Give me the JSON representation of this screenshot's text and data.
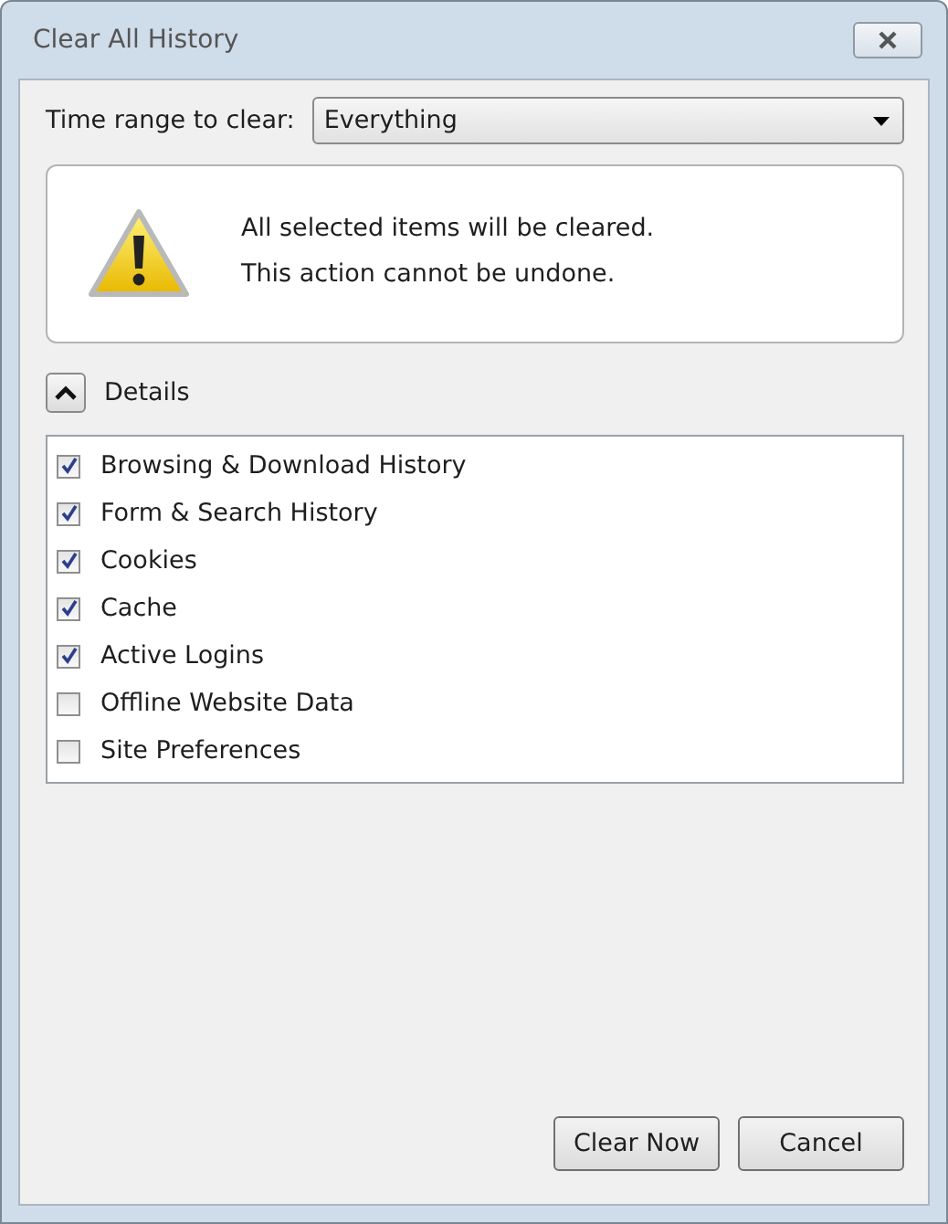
{
  "window": {
    "title": "Clear All History"
  },
  "time_range": {
    "label": "Time range to clear:",
    "value": "Everything"
  },
  "warning": {
    "lines": [
      "All selected items will be cleared.",
      "This action cannot be undone."
    ]
  },
  "details": {
    "label": "Details",
    "expanded": true
  },
  "items": [
    {
      "label": "Browsing & Download History",
      "checked": true
    },
    {
      "label": "Form & Search History",
      "checked": true
    },
    {
      "label": "Cookies",
      "checked": true
    },
    {
      "label": "Cache",
      "checked": true
    },
    {
      "label": "Active Logins",
      "checked": true
    },
    {
      "label": "Offline Website Data",
      "checked": false
    },
    {
      "label": "Site Preferences",
      "checked": false
    }
  ],
  "buttons": [
    "Clear Now",
    "Cancel"
  ]
}
